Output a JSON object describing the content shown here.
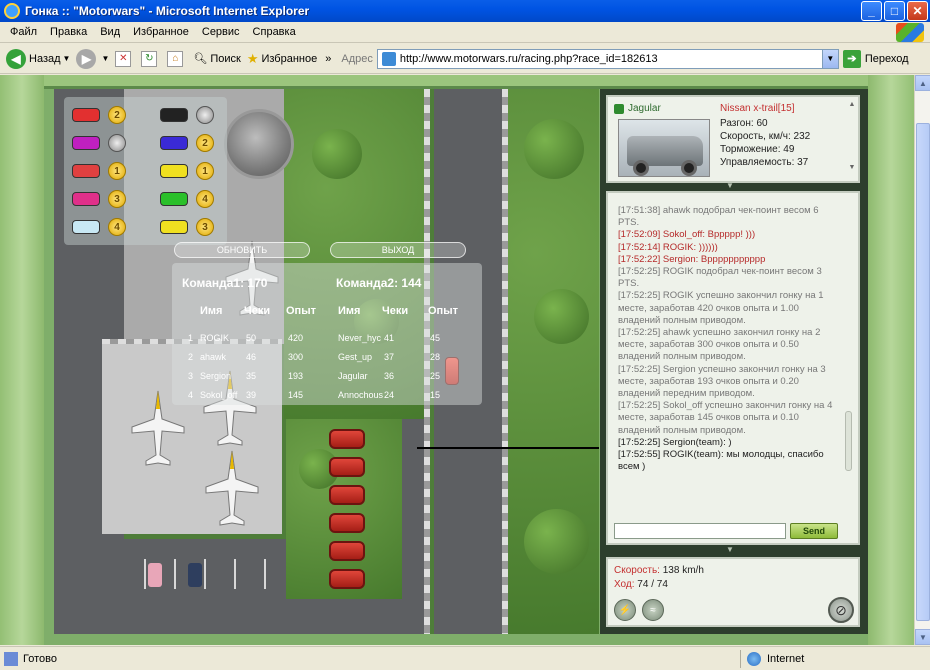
{
  "window": {
    "title": "Гонка :: \"Motorwars\" - Microsoft Internet Explorer",
    "controls": [
      "_",
      "□",
      "✕"
    ]
  },
  "menu": [
    "Файл",
    "Правка",
    "Вид",
    "Избранное",
    "Сервис",
    "Справка"
  ],
  "toolbar": {
    "back": "Назад",
    "search": "Поиск",
    "favorites": "Избранное",
    "address_label": "Адрес",
    "url": "http://www.motorwars.ru/racing.php?race_id=182613",
    "go": "Переход",
    "more": "»"
  },
  "status": {
    "text": "Готово",
    "zone": "Internet"
  },
  "overlay": {
    "refresh_btn": "ОБНОВИТЬ",
    "exit_btn": "ВЫХОД",
    "team1_label": "Команда1: 170",
    "team2_label": "Команда2: 144",
    "col_name": "Имя",
    "col_checks": "Чеки",
    "col_exp": "Опыт",
    "team1": [
      {
        "n": "1",
        "name": "ROGIK",
        "checks": "50",
        "exp": "420"
      },
      {
        "n": "2",
        "name": "ahawk",
        "checks": "46",
        "exp": "300"
      },
      {
        "n": "3",
        "name": "Sergion",
        "checks": "35",
        "exp": "193"
      },
      {
        "n": "4",
        "name": "Sokol_off",
        "checks": "39",
        "exp": "145"
      }
    ],
    "team2": [
      {
        "name": "Never_hyc",
        "checks": "41",
        "exp": "45"
      },
      {
        "name": "Gest_up",
        "checks": "37",
        "exp": "28"
      },
      {
        "name": "Jagular",
        "checks": "36",
        "exp": "25"
      },
      {
        "name": "Annochous",
        "checks": "24",
        "exp": "15"
      }
    ],
    "positions": [
      "2",
      "",
      "",
      "2",
      "1",
      "1",
      "3",
      "4",
      "4",
      "3"
    ]
  },
  "car_card": {
    "player": "Jagular",
    "car_name": "Nissan x-trail[15]",
    "stats": [
      "Разгон: 60",
      "Скорость, км/ч: 232",
      "Торможение: 49",
      "Управляемость: 37"
    ]
  },
  "chat": {
    "lines": [
      {
        "t": "[17:51:38] ahawk подобрал чек-поинт весом 6 PTS.",
        "c": "grey"
      },
      {
        "t": "[17:52:09] Sokol_off: Bppppp! )))",
        "c": "red"
      },
      {
        "t": "[17:52:14] ROGIK: ))))))",
        "c": "red"
      },
      {
        "t": "[17:52:22] Sergion: Bppppppppppp",
        "c": "red"
      },
      {
        "t": "[17:52:25] ROGIK подобрал чек-поинт весом 3 PTS.",
        "c": "grey"
      },
      {
        "t": "[17:52:25] ROGIK успешно закончил гонку на 1 месте, заработав 420 очков опыта и 1.00 владений полным приводом.",
        "c": "grey"
      },
      {
        "t": "[17:52:25] ahawk успешно закончил гонку на 2 месте, заработав 300 очков опыта и 0.50 владений полным приводом.",
        "c": "grey"
      },
      {
        "t": "[17:52:25] Sergion успешно закончил гонку на 3 месте, заработав 193 очков опыта и 0.20 владений передним приводом.",
        "c": "grey"
      },
      {
        "t": "[17:52:25] Sokol_off успешно закончил гонку на 4 месте, заработав 145 очков опыта и 0.10 владений полным приводом.",
        "c": "grey"
      },
      {
        "t": "[17:52:25] Sergion(team): )",
        "c": "dark"
      },
      {
        "t": "[17:52:55] ROGIK(team): мы молодцы, спасибо всем )",
        "c": "dark"
      }
    ],
    "send": "Send",
    "input_value": ""
  },
  "speed_card": {
    "speed_label": "Скорость:",
    "speed_value": "138 km/h",
    "moves_label": "Ход:",
    "moves_value": "74 / 74"
  }
}
